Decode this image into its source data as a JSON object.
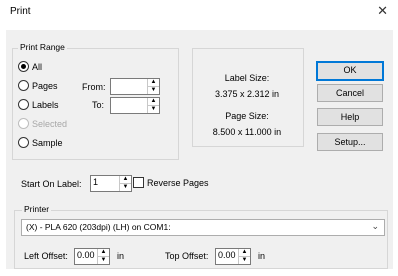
{
  "window": {
    "title": "Print",
    "close_glyph": "✕"
  },
  "print_range": {
    "group_label": "Print Range",
    "options": [
      {
        "label": "All",
        "checked": true,
        "disabled": false
      },
      {
        "label": "Pages",
        "checked": false,
        "disabled": false
      },
      {
        "label": "Labels",
        "checked": false,
        "disabled": false
      },
      {
        "label": "Selected",
        "checked": false,
        "disabled": true
      },
      {
        "label": "Sample",
        "checked": false,
        "disabled": false
      }
    ],
    "from_label": "From:",
    "to_label": "To:",
    "from_value": "",
    "to_value": ""
  },
  "info": {
    "label_size_caption": "Label Size:",
    "label_size_value": "3.375 x 2.312 in",
    "page_size_caption": "Page Size:",
    "page_size_value": "8.500 x 11.000 in"
  },
  "buttons": {
    "ok": "OK",
    "cancel": "Cancel",
    "help": "Help",
    "setup": "Setup..."
  },
  "start": {
    "label": "Start On Label:",
    "value": "1",
    "reverse_label": "Reverse Pages",
    "reverse_checked": false
  },
  "printer": {
    "group_label": "Printer",
    "selected": "(X) - PLA 620 (203dpi) (LH) on COM1:",
    "chevron": "⌄",
    "left_offset_label": "Left Offset:",
    "left_offset_value": "0.00",
    "left_offset_unit": "in",
    "top_offset_label": "Top Offset:",
    "top_offset_value": "0.00",
    "top_offset_unit": "in"
  },
  "spin_glyphs": {
    "up": "▲",
    "down": "▼"
  }
}
